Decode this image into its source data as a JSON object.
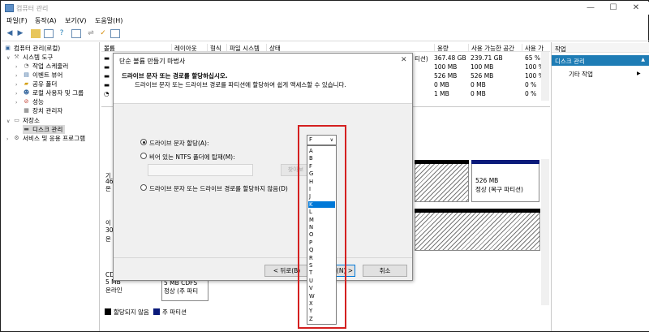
{
  "window": {
    "title": "컴퓨터 관리",
    "min": "—",
    "max": "☐",
    "close": "✕"
  },
  "menu": [
    "파일(F)",
    "동작(A)",
    "보기(V)",
    "도움말(H)"
  ],
  "tree": {
    "root": "컴퓨터 관리(로컬)",
    "system_tools": "시스템 도구",
    "task_scheduler": "작업 스케줄러",
    "event_viewer": "이벤트 뷰어",
    "shared_folders": "공유 폴더",
    "local_users": "로컬 사용자 및 그룹",
    "performance": "성능",
    "device_manager": "장치 관리자",
    "storage": "저장소",
    "disk_management": "디스크 관리",
    "services": "서비스 및 응용 프로그램"
  },
  "volume_table": {
    "headers": [
      "볼륨",
      "레이아웃",
      "형식",
      "파일 시스템",
      "상태",
      "용량",
      "사용 가능한 공간",
      "사용 가"
    ],
    "partial_col": [
      "티션)",
      "",
      "",
      "",
      ""
    ],
    "rows": [
      {
        "capacity": "367.48 GB",
        "free": "239.71 GB",
        "pct": "65 %"
      },
      {
        "capacity": "100 MB",
        "free": "100 MB",
        "pct": "100 %"
      },
      {
        "capacity": "526 MB",
        "free": "526 MB",
        "pct": "100 %"
      },
      {
        "capacity": "0 MB",
        "free": "0 MB",
        "pct": "0 %"
      },
      {
        "capacity": "1 MB",
        "free": "0 MB",
        "pct": "0 %"
      }
    ]
  },
  "lower_pane": {
    "disk0_labels": [
      "기",
      "46",
      "온"
    ],
    "disk0_part_size": "526 MB",
    "disk0_part_status": "정상 (복구 파티션)",
    "disk1_labels": [
      "이",
      "30",
      "온"
    ],
    "cd_labels": [
      "CD",
      "5 MB",
      "온라인"
    ],
    "cd_part": "5 MB CDFS",
    "cd_part_status": "정상 (주 파티"
  },
  "legend": {
    "unallocated": "할당되지 않음",
    "primary": "주 파티션"
  },
  "actions": {
    "header": "작업",
    "selected": "디스크 관리",
    "more": "기타 작업",
    "arrow": "▲",
    "more_arrow": "▶"
  },
  "dialog": {
    "title": "단순 볼륨 만들기 마법사",
    "heading": "드라이브 문자 또는 경로를 할당하십시오.",
    "subheading": "드라이브 문자 또는 드라이브 경로를 파티션에 할당하여 쉽게 액세스할 수 있습니다.",
    "opt_assign": "드라이브 문자 할당(A):",
    "opt_mount": "비어 있는 NTFS 폴더에 탑재(M):",
    "opt_none": "드라이브 문자 또는 드라이브 경로를 할당하지 않음(D)",
    "browse": "찾아보",
    "back": "< 뒤로(B)",
    "next": "(N) >",
    "cancel": "취소",
    "selected_letter": "F",
    "letters": [
      "A",
      "B",
      "F",
      "G",
      "H",
      "I",
      "J",
      "K",
      "L",
      "M",
      "N",
      "O",
      "P",
      "Q",
      "R",
      "S",
      "T",
      "U",
      "V",
      "W",
      "X",
      "Y",
      "Z"
    ],
    "highlighted": "K"
  }
}
